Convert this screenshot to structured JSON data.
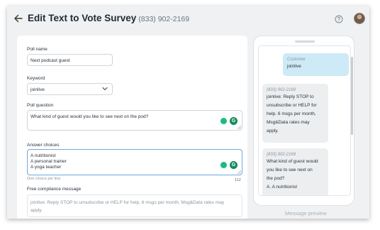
{
  "header": {
    "title": "Edit Text to Vote Survey",
    "phone_number": "(833) 902-2169"
  },
  "form": {
    "poll_name": {
      "label": "Poll name",
      "value": "Next podcast guest"
    },
    "keyword": {
      "label": "Keyword",
      "selected": "joinlive"
    },
    "poll_question": {
      "label": "Poll question",
      "value": "What kind of guest would you like to see next on the pod?"
    },
    "answer_choices": {
      "label": "Answer choices",
      "lines": [
        "A nutritionist",
        "A personal trainer",
        "A yoga teacher"
      ],
      "hint": "One choice per line",
      "char_count": "112"
    },
    "compliance": {
      "label": "Free compliance message",
      "lines": [
        "joinlive: Reply STOP to unsubscribe or HELP for help. 6 msgs per month, Msg&Data rates may",
        "apply."
      ]
    }
  },
  "preview": {
    "customer": {
      "sender": "Customer",
      "text": "joinlive"
    },
    "reply1": {
      "sender": "(833) 902-2169",
      "lines": [
        "joinlive: Reply STOP to",
        "unsubscribe or HELP for",
        "help. 6 msgs per month,",
        "Msg&Data rates may",
        "apply."
      ]
    },
    "reply2": {
      "sender": "(833) 902-2169",
      "lines": [
        "What kind of guest would",
        "you like to see next on",
        "the pod?",
        "A. A nutritionist"
      ]
    },
    "label": "Message preview"
  },
  "colors": {
    "accent": "#1eb980",
    "bubble_out": "#cdeaf6",
    "bubble_in": "#eceef0",
    "focus": "#6fa8dc"
  },
  "icons": {
    "back": "arrow-left-icon",
    "help": "question-circle-icon",
    "dropdown": "chevron-down-icon",
    "suggest": "lightbulb-icon",
    "grammar": "grammarly-g-icon"
  }
}
